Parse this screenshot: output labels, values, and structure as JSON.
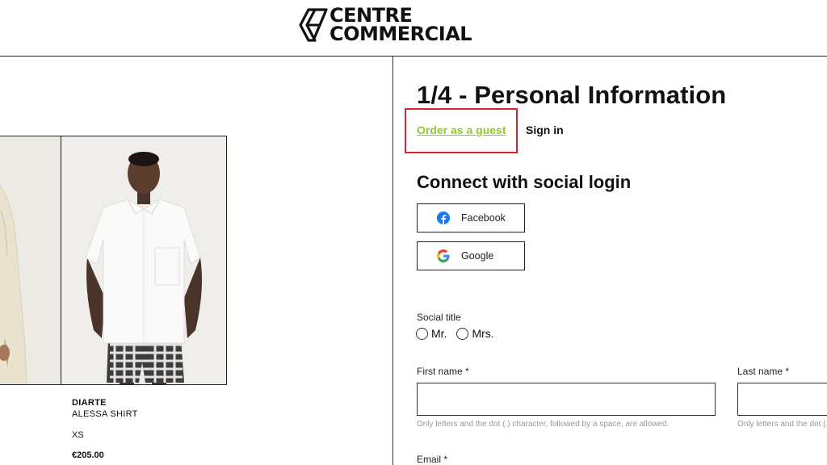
{
  "header": {
    "brand_line1": "CENTRE",
    "brand_line2": "COMMERCIAL"
  },
  "product": {
    "brand": "DIARTE",
    "name": "ALESSA SHIRT",
    "size": "XS",
    "price": "€205.00"
  },
  "checkout": {
    "step_title": "1/4 - Personal Information",
    "tabs": {
      "guest": "Order as a guest",
      "signin": "Sign in"
    },
    "social": {
      "heading": "Connect with social login",
      "facebook": "Facebook",
      "google": "Google"
    },
    "form": {
      "social_title_label": "Social title",
      "options": [
        "Mr.",
        "Mrs."
      ],
      "first_name_label": "First name *",
      "last_name_label": "Last name *",
      "name_hint": "Only letters and the dot (.) character, followed by a space, are allowed.",
      "last_name_hint": "Only letters and the dot (.) character, followed by a space, are allowed.",
      "email_label": "Email *",
      "first_name_value": "",
      "last_name_value": ""
    }
  },
  "colors": {
    "highlight_border": "#d8232a",
    "guest_link": "#8ccc2a",
    "facebook_blue": "#1877f2"
  }
}
